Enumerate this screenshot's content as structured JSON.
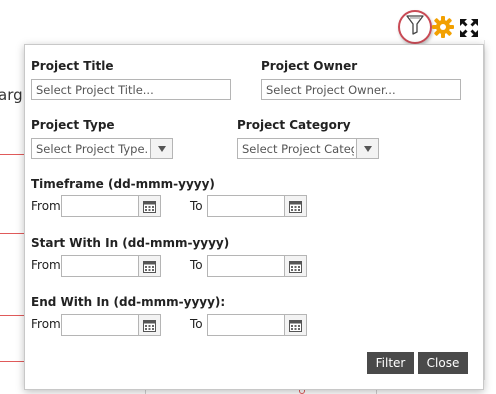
{
  "background": {
    "fragment_text": "arg"
  },
  "toolbar": {
    "filter_icon": "filter-funnel-icon",
    "settings_icon": "gear-icon",
    "expand_icon": "expand-icon",
    "gear_color": "#f2a000",
    "highlight_color": "#c94a55"
  },
  "filter_panel": {
    "project_title": {
      "label": "Project Title",
      "placeholder": "Select Project Title..."
    },
    "project_owner": {
      "label": "Project Owner",
      "placeholder": "Select Project Owner..."
    },
    "project_type": {
      "label": "Project Type",
      "value": "Select Project Type..."
    },
    "project_category": {
      "label": "Project Category",
      "value": "Select Project Catego"
    },
    "timeframe": {
      "label": "Timeframe (dd-mmm-yyyy)",
      "from_label": "From",
      "to_label": "To",
      "from_value": "",
      "to_value": ""
    },
    "start_with_in": {
      "label": "Start With In (dd-mmm-yyyy)",
      "from_label": "From",
      "to_label": "To",
      "from_value": "",
      "to_value": ""
    },
    "end_with_in": {
      "label": "End With In (dd-mmm-yyyy):",
      "from_label": "From",
      "to_label": "To",
      "from_value": "",
      "to_value": ""
    },
    "filter_button": "Filter",
    "close_button": "Close",
    "button_color": "#4a4a4a"
  }
}
